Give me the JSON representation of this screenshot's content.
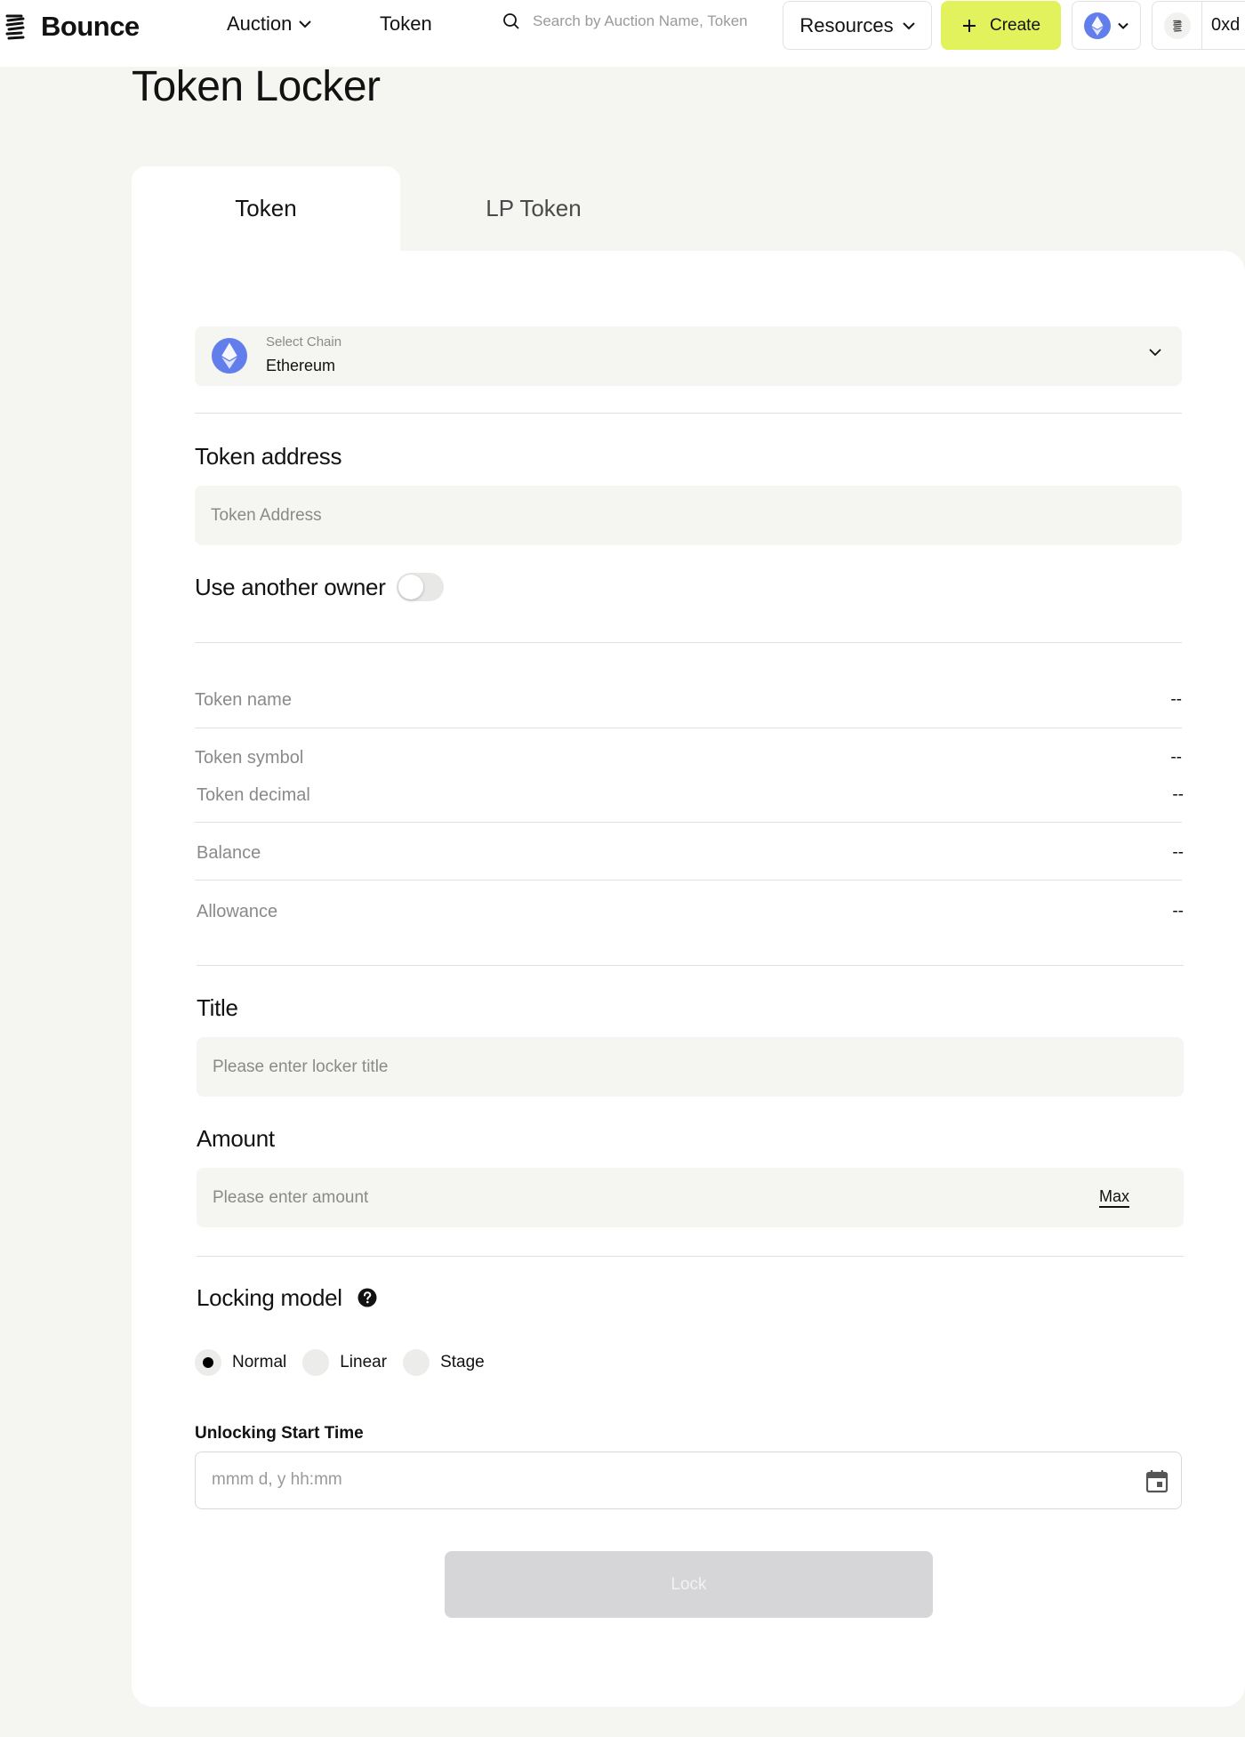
{
  "header": {
    "brand": "Bounce",
    "nav_auction": "Auction",
    "nav_token": "Token",
    "search_placeholder": "Search by Auction Name, Token",
    "resources_label": "Resources",
    "create_label": "Create",
    "wallet_address": "0xd",
    "accent_color": "#e1f25c"
  },
  "page": {
    "title": "Token Locker"
  },
  "tabs": [
    {
      "label": "Token",
      "active": true
    },
    {
      "label": "LP Token",
      "active": false
    }
  ],
  "form": {
    "chain": {
      "label": "Select Chain",
      "value": "Ethereum",
      "icon": "ethereum-icon"
    },
    "token_address": {
      "label": "Token address",
      "placeholder": "Token Address"
    },
    "another_owner": {
      "label": "Use another owner",
      "enabled": false
    },
    "info": [
      {
        "label": "Token name",
        "value": "--"
      },
      {
        "label": "Token symbol",
        "value": "--"
      },
      {
        "label": "Token decimal",
        "value": "--"
      },
      {
        "label": "Balance",
        "value": "--"
      },
      {
        "label": "Allowance",
        "value": "--"
      }
    ],
    "title": {
      "label": "Title",
      "placeholder": "Please enter locker title"
    },
    "amount": {
      "label": "Amount",
      "placeholder": "Please enter amount",
      "max_label": "Max"
    },
    "locking_model": {
      "label": "Locking model",
      "options": [
        "Normal",
        "Linear",
        "Stage"
      ],
      "selected": "Normal"
    },
    "unlocking_start_time": {
      "label": "Unlocking Start Time",
      "placeholder": "mmm d, y  hh:mm"
    },
    "lock_button": "Lock"
  }
}
